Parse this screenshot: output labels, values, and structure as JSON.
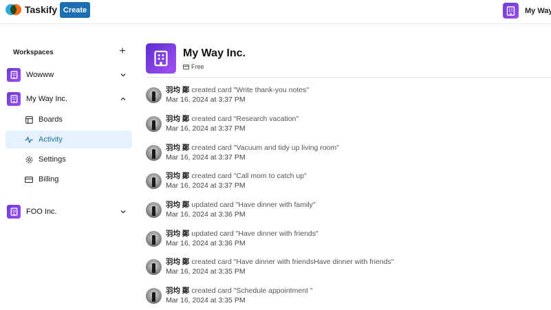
{
  "app": {
    "name": "Taskify",
    "create_label": "Create",
    "colors": {
      "primary": "#1c6fb3",
      "org_purple": "#7b3fe4",
      "active_bg": "#e6f2fb",
      "active_text": "#1f6fa8"
    }
  },
  "header": {
    "org_switcher_label": "My Way"
  },
  "sidebar": {
    "workspaces_label": "Workspaces",
    "add_icon": "plus-icon",
    "workspaces": [
      {
        "name": "Wowww",
        "expanded": false
      },
      {
        "name": "My Way Inc.",
        "expanded": true,
        "items": [
          {
            "label": "Boards",
            "icon": "board-icon"
          },
          {
            "label": "Activity",
            "icon": "activity-icon",
            "active": true
          },
          {
            "label": "Settings",
            "icon": "gear-icon"
          },
          {
            "label": "Billing",
            "icon": "credit-card-icon"
          }
        ]
      },
      {
        "name": "FOO Inc.",
        "expanded": false
      }
    ]
  },
  "main": {
    "org_name": "My Way Inc.",
    "plan": "Free",
    "activities": [
      {
        "user": "羽均 鄭",
        "action": "created card \"Write thank-you notes\"",
        "time": "Mar 16, 2024 at 3:37 PM"
      },
      {
        "user": "羽均 鄭",
        "action": "created card \"Research vacation\"",
        "time": "Mar 16, 2024 at 3:37 PM"
      },
      {
        "user": "羽均 鄭",
        "action": "created card \"Vacuum and tidy up living room\"",
        "time": "Mar 16, 2024 at 3:37 PM"
      },
      {
        "user": "羽均 鄭",
        "action": "created card \"Call mom to catch up\"",
        "time": "Mar 16, 2024 at 3:37 PM"
      },
      {
        "user": "羽均 鄭",
        "action": "updated card \"Have dinner with family\"",
        "time": "Mar 16, 2024 at 3:36 PM"
      },
      {
        "user": "羽均 鄭",
        "action": "updated card \"Have dinner with friends\"",
        "time": "Mar 16, 2024 at 3:36 PM"
      },
      {
        "user": "羽均 鄭",
        "action": "created card \"Have dinner with friendsHave dinner with friends\"",
        "time": "Mar 16, 2024 at 3:35 PM"
      },
      {
        "user": "羽均 鄭",
        "action": "created card \"Schedule appointment \"",
        "time": "Mar 16, 2024 at 3:35 PM"
      }
    ]
  }
}
